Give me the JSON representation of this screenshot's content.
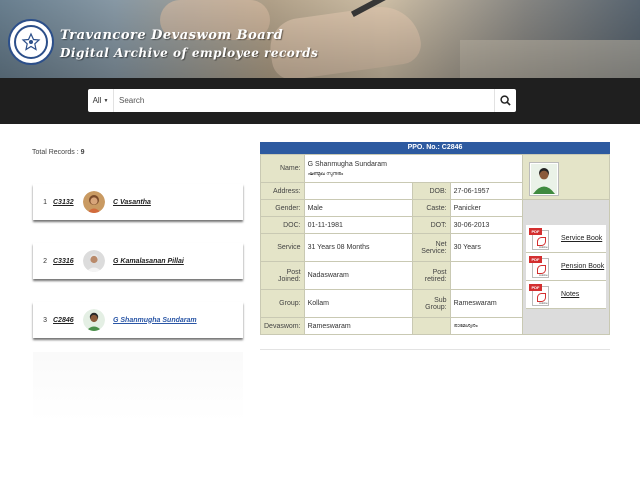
{
  "banner": {
    "title": "Travancore Devaswom Board",
    "subtitle": "Digital Archive of employee records",
    "logo_icon": "emblem-icon"
  },
  "search": {
    "scope_label": "All",
    "placeholder": "Search",
    "button_icon": "search-icon"
  },
  "records": {
    "total_label": "Total Records :",
    "total_count": "9",
    "items": [
      {
        "index": "1",
        "ppo": "C3132",
        "name": "C Vasantha"
      },
      {
        "index": "2",
        "ppo": "C3316",
        "name": "G Kamalasanan Pillai"
      },
      {
        "index": "3",
        "ppo": "C2846",
        "name": "G Shanmugha Sundaram"
      }
    ]
  },
  "detail": {
    "ppo_header": "PPO. No.: C2846",
    "name_label": "Name:",
    "name_value": "G Shanmugha Sundaram",
    "name_local": "ഷണ്മുഖ സുന്ദരം",
    "address_label": "Address:",
    "address_value": "",
    "dob_label": "DOB:",
    "dob_value": "27-06-1957",
    "gender_label": "Gender:",
    "gender_value": "Male",
    "caste_label": "Caste:",
    "caste_value": "Panicker",
    "doc_label": "DOC:",
    "doc_value": "01-11-1981",
    "dot_label": "DOT:",
    "dot_value": "30-06-2013",
    "service_label": "Service",
    "service_value": "31 Years 08 Months",
    "net_service_label": "Net Service:",
    "net_service_value": "30 Years",
    "post_joined_label": "Post Joined:",
    "post_joined_value": "Nadaswaram",
    "post_retired_label": "Post retired:",
    "post_retired_value": "",
    "group_label": "Group:",
    "group_value": "Kollam",
    "sub_group_label": "Sub Group:",
    "sub_group_value": "Rameswaram",
    "devaswom_label": "Devaswom:",
    "devaswom_value": "Rameswaram",
    "devaswom_local": "രാമേശ്വരം",
    "documents": [
      {
        "label": "Service Book",
        "icon": "pdf-icon"
      },
      {
        "label": "Pension Book",
        "icon": "pdf-icon"
      },
      {
        "label": "Notes",
        "icon": "pdf-icon"
      }
    ]
  }
}
